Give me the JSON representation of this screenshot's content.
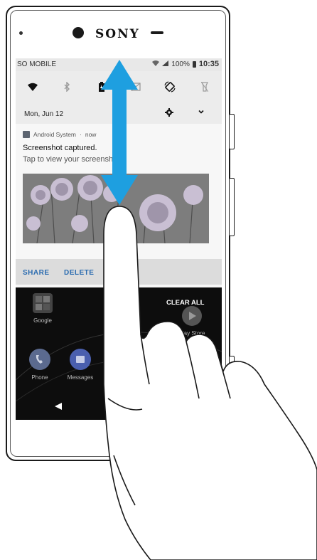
{
  "device": {
    "brand": "SONY"
  },
  "statusbar": {
    "carrier": "SO MOBILE",
    "battery_level": "100%",
    "time": "10:35"
  },
  "quick_settings": {
    "tiles": [
      "wifi-icon",
      "bluetooth-icon",
      "battery-saver-icon",
      "nfc-icon",
      "auto-rotate-icon",
      "flashlight-icon"
    ],
    "date": "Mon, Jun 12"
  },
  "notification": {
    "app_name": "Android System",
    "time_label": "now",
    "title": "Screenshot captured.",
    "body": "Tap to view your screenshot",
    "actions": {
      "share": "SHARE",
      "delete": "DELETE"
    }
  },
  "home": {
    "clear_all": "CLEAR ALL",
    "apps": {
      "google": "Google",
      "play_store": "Play Store",
      "phone": "Phone",
      "messages": "Messages"
    }
  },
  "gesture": {
    "arrow_color": "#1e9fe0",
    "direction": "swipe-down"
  }
}
